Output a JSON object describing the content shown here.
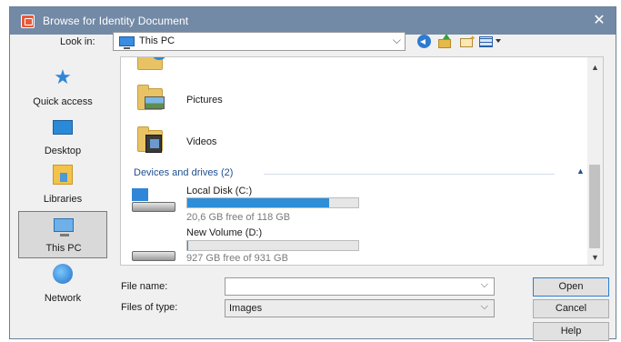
{
  "window": {
    "title": "Browse for Identity Document",
    "close_glyph": "✕"
  },
  "lookin": {
    "label": "Look in:",
    "value": "This PC"
  },
  "toolbar": {
    "icons": [
      "back-icon",
      "up-folder-icon",
      "new-folder-icon",
      "view-menu-icon"
    ]
  },
  "places": [
    {
      "label": "Quick access",
      "icon": "star-icon"
    },
    {
      "label": "Desktop",
      "icon": "desktop-icon"
    },
    {
      "label": "Libraries",
      "icon": "libraries-icon"
    },
    {
      "label": "This PC",
      "icon": "computer-icon",
      "selected": true
    },
    {
      "label": "Network",
      "icon": "network-icon"
    }
  ],
  "folders": [
    {
      "name": "Pictures"
    },
    {
      "name": "Videos"
    }
  ],
  "devices_group": {
    "label": "Devices and drives (2)"
  },
  "drives": [
    {
      "name": "Local Disk (C:)",
      "free_text": "20,6 GB free of 118 GB",
      "used_fraction": 0.83
    },
    {
      "name": "New Volume (D:)",
      "free_text": "927 GB free of 931 GB",
      "used_fraction": 0.004
    }
  ],
  "form": {
    "file_name_label": "File name:",
    "file_name_value": "",
    "files_of_type_label": "Files of type:",
    "files_of_type_value": "Images"
  },
  "buttons": {
    "open": "Open",
    "cancel": "Cancel",
    "help": "Help"
  },
  "colors": {
    "titlebar": "#738aa6",
    "drive_bar_fill": "#2e8ed8",
    "group_text": "#1e4f8f"
  }
}
